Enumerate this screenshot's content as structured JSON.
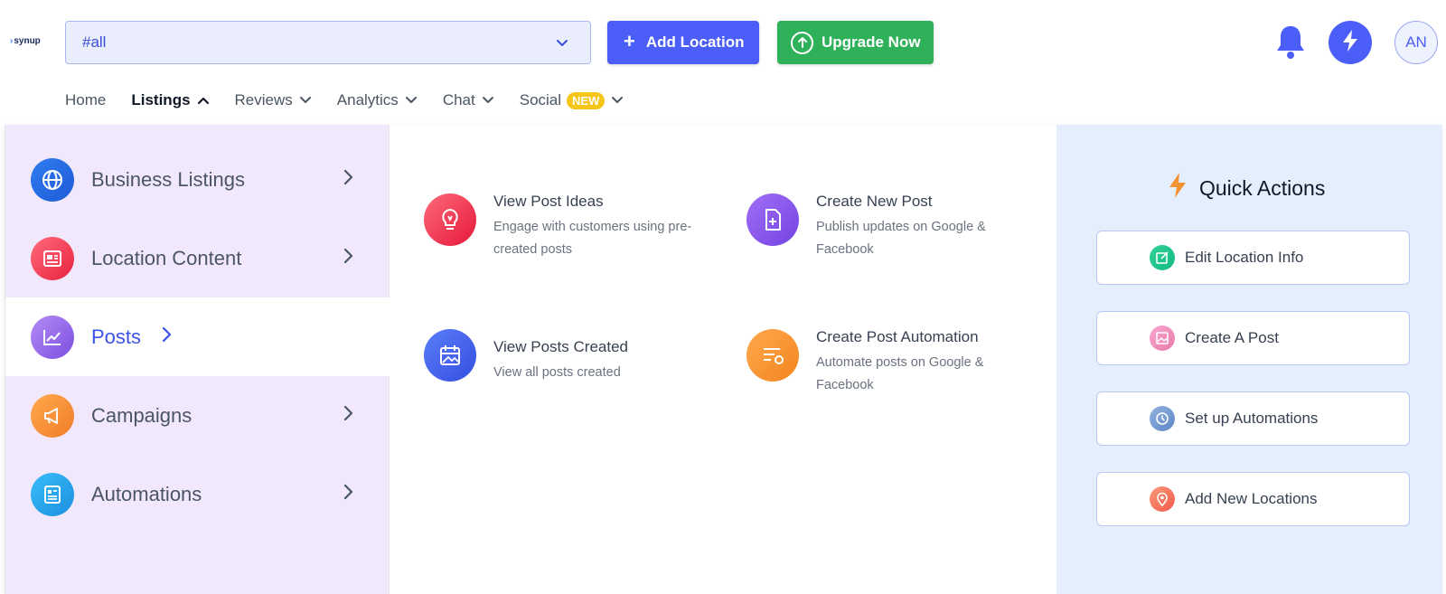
{
  "header": {
    "logo_text": "synup",
    "location_select": {
      "value": "#all"
    },
    "add_location_label": "Add Location",
    "upgrade_label": "Upgrade Now",
    "avatar_initials": "AN"
  },
  "nav": {
    "items": [
      {
        "label": "Home"
      },
      {
        "label": "Listings"
      },
      {
        "label": "Reviews"
      },
      {
        "label": "Analytics"
      },
      {
        "label": "Chat"
      },
      {
        "label": "Social",
        "badge": "NEW"
      }
    ]
  },
  "menu": {
    "categories": [
      {
        "label": "Business Listings",
        "icon": "globe-icon"
      },
      {
        "label": "Location Content",
        "icon": "newspaper-icon"
      },
      {
        "label": "Posts",
        "icon": "chart-line-icon",
        "active": true
      },
      {
        "label": "Campaigns",
        "icon": "megaphone-icon"
      },
      {
        "label": "Automations",
        "icon": "document-icon"
      }
    ],
    "options": [
      {
        "title": "View Post Ideas",
        "desc": "Engage with customers using pre-created posts",
        "icon": "lightbulb-icon"
      },
      {
        "title": "Create New Post",
        "desc": "Publish updates on Google & Facebook",
        "icon": "file-plus-icon"
      },
      {
        "title": "View Posts Created",
        "desc": "View all posts created",
        "icon": "calendar-image-icon"
      },
      {
        "title": "Create Post Automation",
        "desc": "Automate posts on Google & Facebook",
        "icon": "list-gear-icon"
      }
    ],
    "quick_actions": {
      "title": "Quick Actions",
      "items": [
        {
          "label": "Edit Location Info",
          "icon": "edit-icon"
        },
        {
          "label": "Create A Post",
          "icon": "image-icon"
        },
        {
          "label": "Set up Automations",
          "icon": "clock-icon"
        },
        {
          "label": "Add New Locations",
          "icon": "map-pin-icon"
        }
      ]
    }
  },
  "colors": {
    "primary": "#4b5ef7",
    "upgrade": "#2fb15a",
    "left_panel_bg": "#f1e9fb",
    "quick_actions_bg": "#e4eefc"
  }
}
